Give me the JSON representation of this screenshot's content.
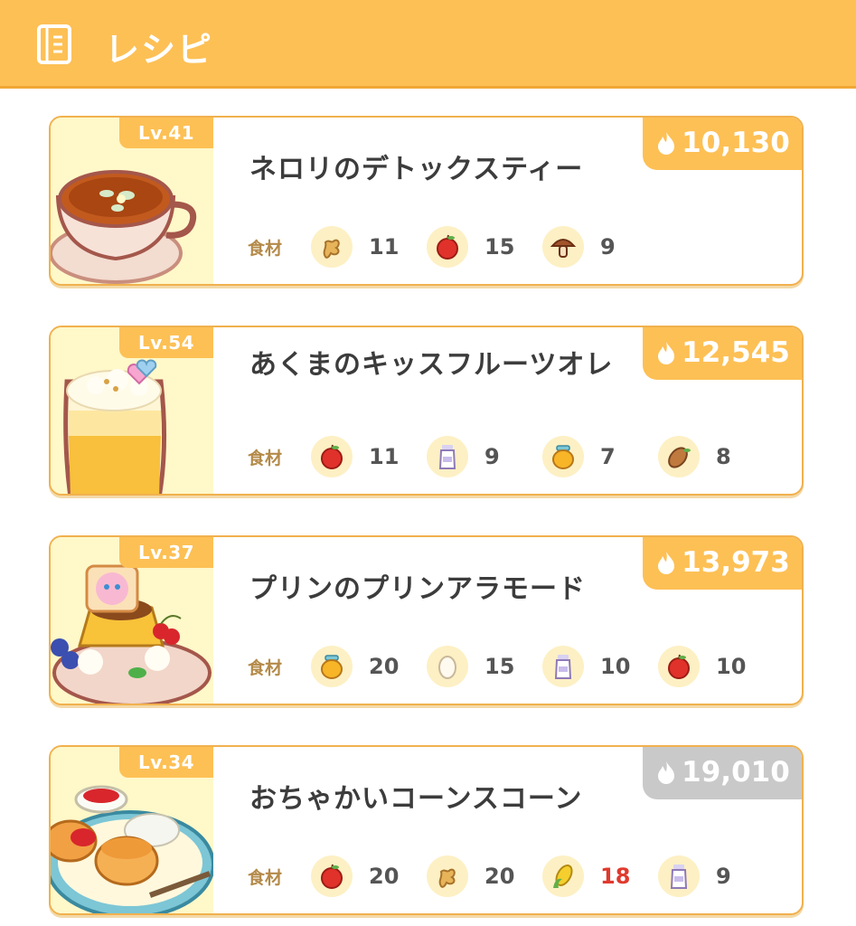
{
  "header": {
    "title": "レシピ",
    "icon": "recipe-book-icon"
  },
  "ingredient_label": "食材",
  "recipes": [
    {
      "level": "Lv.41",
      "name": "ネロリのデトックスティー",
      "energy": "10,130",
      "energy_state": "normal",
      "ingredients": [
        {
          "icon": "ginger-icon",
          "count": "11"
        },
        {
          "icon": "apple-icon",
          "count": "15"
        },
        {
          "icon": "mushroom-icon",
          "count": "9"
        }
      ]
    },
    {
      "level": "Lv.54",
      "name": "あくまのキッスフルーツオレ",
      "energy": "12,545",
      "energy_state": "normal",
      "ingredients": [
        {
          "icon": "apple-icon",
          "count": "11"
        },
        {
          "icon": "milk-icon",
          "count": "9"
        },
        {
          "icon": "honey-icon",
          "count": "7"
        },
        {
          "icon": "cacao-icon",
          "count": "8"
        }
      ]
    },
    {
      "level": "Lv.37",
      "name": "プリンのプリンアラモード",
      "energy": "13,973",
      "energy_state": "normal",
      "ingredients": [
        {
          "icon": "honey-icon",
          "count": "20"
        },
        {
          "icon": "egg-icon",
          "count": "15"
        },
        {
          "icon": "milk-icon",
          "count": "10"
        },
        {
          "icon": "apple-icon",
          "count": "10"
        }
      ]
    },
    {
      "level": "Lv.34",
      "name": "おちゃかいコーンスコーン",
      "energy": "19,010",
      "energy_state": "disabled",
      "ingredients": [
        {
          "icon": "apple-icon",
          "count": "20"
        },
        {
          "icon": "ginger-icon",
          "count": "20"
        },
        {
          "icon": "corn-icon",
          "count": "18",
          "insufficient": true
        },
        {
          "icon": "milk-icon",
          "count": "9"
        }
      ]
    }
  ],
  "colors": {
    "header": "#fdc055",
    "badge": "#fdc055",
    "badge_disabled": "#c9c9c9",
    "insufficient": "#e03a2e",
    "ingredient_label": "#b48a49"
  }
}
